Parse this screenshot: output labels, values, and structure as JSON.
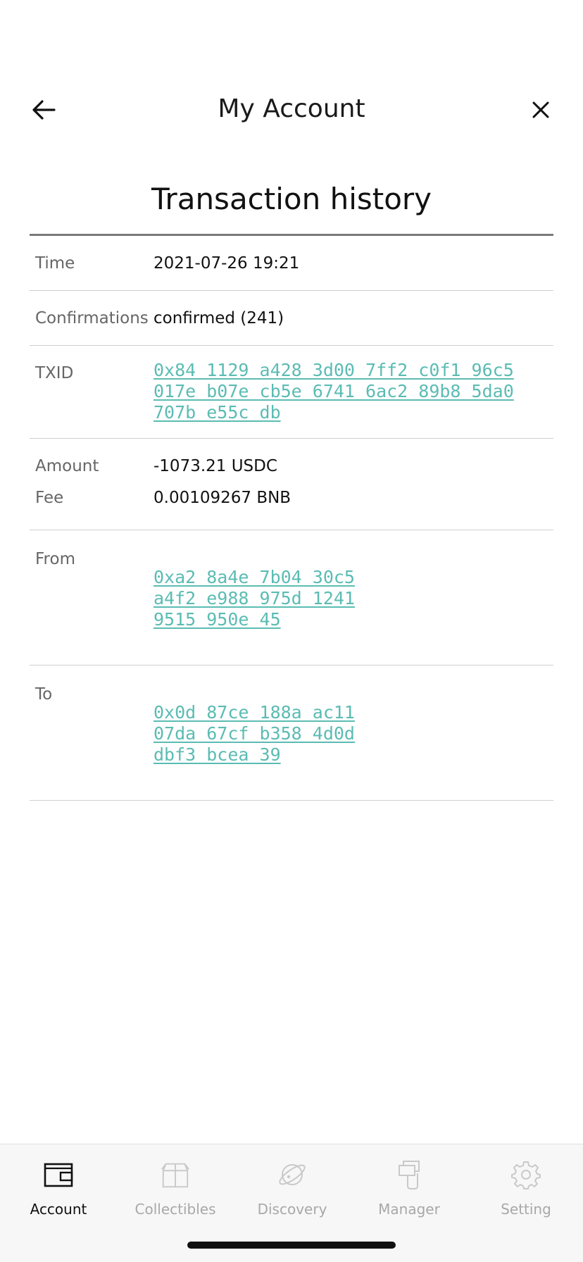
{
  "header": {
    "title": "My Account",
    "back_icon": "arrow-left-icon",
    "close_icon": "close-icon"
  },
  "section": {
    "title": "Transaction history"
  },
  "details": {
    "time": {
      "label": "Time",
      "value": "2021-07-26 19:21"
    },
    "confirmations": {
      "label": "Confirmations",
      "value": "confirmed (241)"
    },
    "txid": {
      "label": "TXID",
      "value": "0x84 1129 a428 3d00 7ff2 c0f1 96c5\n017e b07e cb5e 6741 6ac2 89b8 5da0\n707b e55c db"
    },
    "amount": {
      "label": "Amount",
      "value": "-1073.21 USDC"
    },
    "fee": {
      "label": "Fee",
      "value": "0.00109267 BNB"
    },
    "from": {
      "label": "From",
      "value": "0xa2 8a4e 7b04 30c5\na4f2 e988 975d 1241\n9515 950e 45"
    },
    "to": {
      "label": "To",
      "value": "0x0d 87ce 188a ac11\n07da 67cf b358 4d0d\ndbf3 bcea 39"
    }
  },
  "tabbar": {
    "active": "account",
    "tabs": [
      {
        "id": "account",
        "label": "Account",
        "icon": "wallet-icon"
      },
      {
        "id": "collectibles",
        "label": "Collectibles",
        "icon": "box-icon"
      },
      {
        "id": "discovery",
        "label": "Discovery",
        "icon": "planet-icon"
      },
      {
        "id": "manager",
        "label": "Manager",
        "icon": "cards-icon"
      },
      {
        "id": "setting",
        "label": "Setting",
        "icon": "gear-icon"
      }
    ]
  },
  "colors": {
    "link": "#5bbcb3",
    "label": "#666666",
    "divider": "#cfcfcf",
    "tab_inactive": "#a8a8a8",
    "tab_active": "#111111"
  }
}
